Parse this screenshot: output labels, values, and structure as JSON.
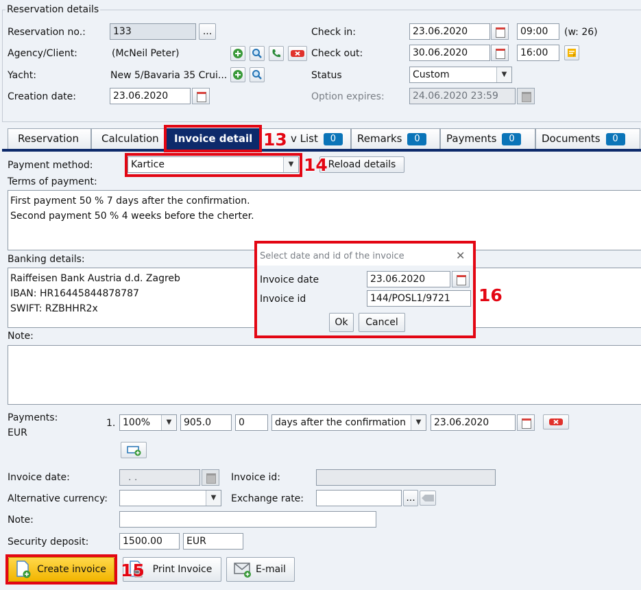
{
  "section_title": "Reservation details",
  "reservation": {
    "no_label": "Reservation no.:",
    "no_value": "133",
    "no_button": "...",
    "agency_label": "Agency/Client:",
    "agency_value": "(McNeil Peter)",
    "yacht_label": "Yacht:",
    "yacht_value": "New 5/Bavaria 35 Crui...",
    "creation_label": "Creation date:",
    "creation_value": "23.06.2020",
    "checkin_label": "Check in:",
    "checkin_date": "23.06.2020",
    "checkin_time": "09:00",
    "week": "(w: 26)",
    "checkout_label": "Check out:",
    "checkout_date": "30.06.2020",
    "checkout_time": "16:00",
    "status_label": "Status",
    "status_value": "Custom",
    "option_label": "Option expires:",
    "option_value": "24.06.2020 23:59"
  },
  "tabs": [
    {
      "label": "Reservation"
    },
    {
      "label": "Calculation"
    },
    {
      "label": "Invoice detail"
    },
    {
      "label": "v List",
      "badge": "0"
    },
    {
      "label": "Remarks",
      "badge": "0"
    },
    {
      "label": "Payments",
      "badge": "0"
    },
    {
      "label": "Documents",
      "badge": "0"
    }
  ],
  "invoice": {
    "payment_method_label": "Payment method:",
    "payment_method_value": "Kartice",
    "reload_button": "Reload details",
    "terms_label": "Terms of payment:",
    "terms_line1": "First payment 50 % 7 days after the confirmation.",
    "terms_line2": "Second payment 50 % 4 weeks before the cherter.",
    "banking_label": "Banking details:",
    "bank_line1": "Raiffeisen Bank Austria d.d. Zagreb",
    "bank_line2": "IBAN: HR16445844878787",
    "bank_line3": "SWIFT: RZBHHR2x",
    "note_label": "Note:",
    "payments_label": "Payments:",
    "currency": "EUR",
    "payment_row": {
      "index": "1.",
      "percent": "100%",
      "amount": "905.0",
      "days": "0",
      "rule": "days after the confirmation",
      "date": "23.06.2020"
    },
    "invoice_date_label": "Invoice date:",
    "invoice_date_value": " .  .",
    "invoice_id_label": "Invoice id:",
    "alt_currency_label": "Alternative currency:",
    "exchange_rate_label": "Exchange rate:",
    "exchange_button": "...",
    "note2_label": "Note:",
    "deposit_label": "Security deposit:",
    "deposit_value": "1500.00",
    "deposit_currency": "EUR"
  },
  "buttons": {
    "create": "Create invoice",
    "print": "Print Invoice",
    "email": "E-mail"
  },
  "dialog": {
    "title": "Select date and id of the invoice",
    "close": "✕",
    "date_label": "Invoice date",
    "date_value": "23.06.2020",
    "id_label": "Invoice id",
    "id_value": "144/POSL1/9721",
    "ok": "Ok",
    "cancel": "Cancel"
  },
  "callouts": {
    "c13": "13",
    "c14": "14",
    "c15": "15",
    "c16": "16"
  },
  "colors": {
    "accent_red": "#e30613",
    "active_tab": "#0d2a6b",
    "badge": "#0a74b8"
  }
}
